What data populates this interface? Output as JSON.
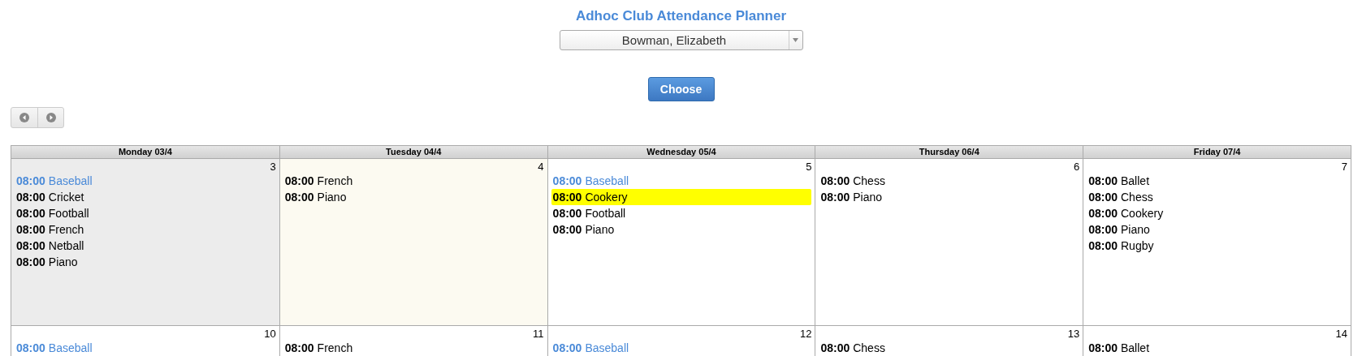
{
  "title": "Adhoc Club Attendance Planner",
  "person_select": {
    "value": "Bowman, Elizabeth"
  },
  "choose_button": "Choose",
  "calendar": {
    "columns": [
      "Monday 03/4",
      "Tuesday 04/4",
      "Wednesday 05/4",
      "Thursday 06/4",
      "Friday 07/4"
    ],
    "weeks": [
      {
        "days": [
          {
            "number": "3",
            "kind": "past",
            "events": [
              {
                "time": "08:00",
                "name": "Baseball",
                "color": "#4a8ad8",
                "highlighted": false
              },
              {
                "time": "08:00",
                "name": "Cricket",
                "color": "#000000",
                "highlighted": false
              },
              {
                "time": "08:00",
                "name": "Football",
                "color": "#000000",
                "highlighted": false
              },
              {
                "time": "08:00",
                "name": "French",
                "color": "#000000",
                "highlighted": false
              },
              {
                "time": "08:00",
                "name": "Netball",
                "color": "#000000",
                "highlighted": false
              },
              {
                "time": "08:00",
                "name": "Piano",
                "color": "#000000",
                "highlighted": false
              }
            ]
          },
          {
            "number": "4",
            "kind": "today",
            "events": [
              {
                "time": "08:00",
                "name": "French",
                "color": "#000000",
                "highlighted": false
              },
              {
                "time": "08:00",
                "name": "Piano",
                "color": "#000000",
                "highlighted": false
              }
            ]
          },
          {
            "number": "5",
            "kind": "normal",
            "events": [
              {
                "time": "08:00",
                "name": "Baseball",
                "color": "#4a8ad8",
                "highlighted": false
              },
              {
                "time": "08:00",
                "name": "Cookery",
                "color": "#000000",
                "highlighted": true
              },
              {
                "time": "08:00",
                "name": "Football",
                "color": "#000000",
                "highlighted": false
              },
              {
                "time": "08:00",
                "name": "Piano",
                "color": "#000000",
                "highlighted": false
              }
            ]
          },
          {
            "number": "6",
            "kind": "normal",
            "events": [
              {
                "time": "08:00",
                "name": "Chess",
                "color": "#000000",
                "highlighted": false
              },
              {
                "time": "08:00",
                "name": "Piano",
                "color": "#000000",
                "highlighted": false
              }
            ]
          },
          {
            "number": "7",
            "kind": "normal",
            "events": [
              {
                "time": "08:00",
                "name": "Ballet",
                "color": "#000000",
                "highlighted": false
              },
              {
                "time": "08:00",
                "name": "Chess",
                "color": "#000000",
                "highlighted": false
              },
              {
                "time": "08:00",
                "name": "Cookery",
                "color": "#000000",
                "highlighted": false
              },
              {
                "time": "08:00",
                "name": "Piano",
                "color": "#000000",
                "highlighted": false
              },
              {
                "time": "08:00",
                "name": "Rugby",
                "color": "#000000",
                "highlighted": false
              }
            ]
          }
        ]
      },
      {
        "days": [
          {
            "number": "10",
            "kind": "normal",
            "events": [
              {
                "time": "08:00",
                "name": "Baseball",
                "color": "#4a8ad8",
                "highlighted": false
              }
            ]
          },
          {
            "number": "11",
            "kind": "normal",
            "events": [
              {
                "time": "08:00",
                "name": "French",
                "color": "#000000",
                "highlighted": false
              }
            ]
          },
          {
            "number": "12",
            "kind": "normal",
            "events": [
              {
                "time": "08:00",
                "name": "Baseball",
                "color": "#4a8ad8",
                "highlighted": false
              }
            ]
          },
          {
            "number": "13",
            "kind": "normal",
            "events": [
              {
                "time": "08:00",
                "name": "Chess",
                "color": "#000000",
                "highlighted": false
              }
            ]
          },
          {
            "number": "14",
            "kind": "normal",
            "events": [
              {
                "time": "08:00",
                "name": "Ballet",
                "color": "#000000",
                "highlighted": false
              }
            ]
          }
        ]
      }
    ]
  }
}
